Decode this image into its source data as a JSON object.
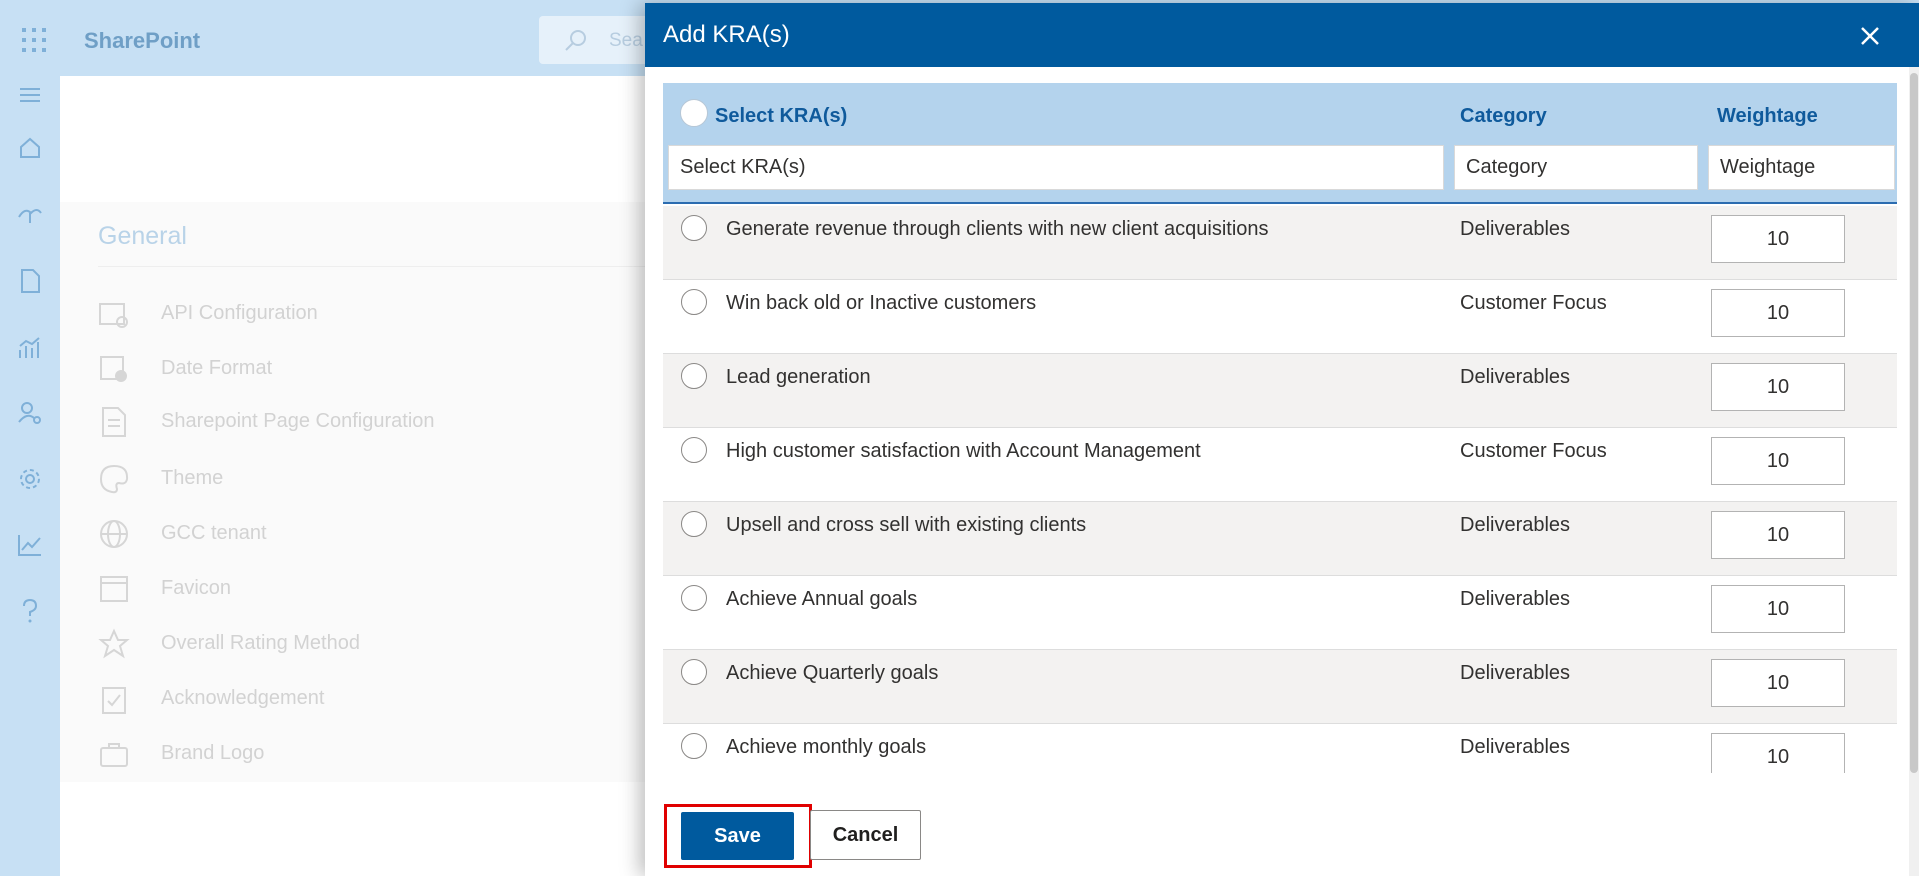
{
  "suite_bar": {
    "app_name": "SharePoint",
    "search_placeholder": "Sea"
  },
  "left_rail": {
    "icons": [
      "menu-icon",
      "home-icon",
      "sites-icon",
      "document-icon",
      "chart-icon",
      "user-settings-icon",
      "gear-icon",
      "trend-icon",
      "help-icon"
    ]
  },
  "general_panel": {
    "title": "General",
    "items": [
      {
        "label": "API Configuration",
        "icon": "api-config-icon"
      },
      {
        "label": "Date Format",
        "icon": "calendar-clock-icon"
      },
      {
        "label": "Sharepoint Page Configuration",
        "icon": "page-config-icon"
      },
      {
        "label": "Theme",
        "icon": "palette-icon"
      },
      {
        "label": "GCC tenant",
        "icon": "globe-icon"
      },
      {
        "label": "Favicon",
        "icon": "window-icon"
      },
      {
        "label": "Overall Rating Method",
        "icon": "star-icon"
      },
      {
        "label": "Acknowledgement",
        "icon": "clipboard-check-icon"
      },
      {
        "label": "Brand Logo",
        "icon": "briefcase-icon"
      }
    ]
  },
  "modal": {
    "title": "Add KRA(s)",
    "columns": {
      "kra": "Select KRA(s)",
      "category": "Category",
      "weightage": "Weightage"
    },
    "filters": {
      "kra_placeholder": "Select KRA(s)",
      "category_placeholder": "Category",
      "weightage_placeholder": "Weightage"
    },
    "rows": [
      {
        "kra": "Generate revenue through clients with new client acquisitions",
        "category": "Deliverables",
        "weightage": "10"
      },
      {
        "kra": "Win back old or Inactive customers",
        "category": "Customer Focus",
        "weightage": "10"
      },
      {
        "kra": "Lead generation",
        "category": "Deliverables",
        "weightage": "10"
      },
      {
        "kra": "High customer satisfaction with Account Management",
        "category": "Customer Focus",
        "weightage": "10"
      },
      {
        "kra": "Upsell and cross sell with existing clients",
        "category": "Deliverables",
        "weightage": "10"
      },
      {
        "kra": "Achieve Annual goals",
        "category": "Deliverables",
        "weightage": "10"
      },
      {
        "kra": "Achieve Quarterly goals",
        "category": "Deliverables",
        "weightage": "10"
      },
      {
        "kra": "Achieve monthly goals",
        "category": "Deliverables",
        "weightage": "10"
      }
    ],
    "save_label": "Save",
    "cancel_label": "Cancel"
  },
  "colors": {
    "header_blue": "#005a9e",
    "suite_bar": "#c7e0f4",
    "grid_header": "#b4d3ed",
    "highlight_red": "#e00000"
  }
}
